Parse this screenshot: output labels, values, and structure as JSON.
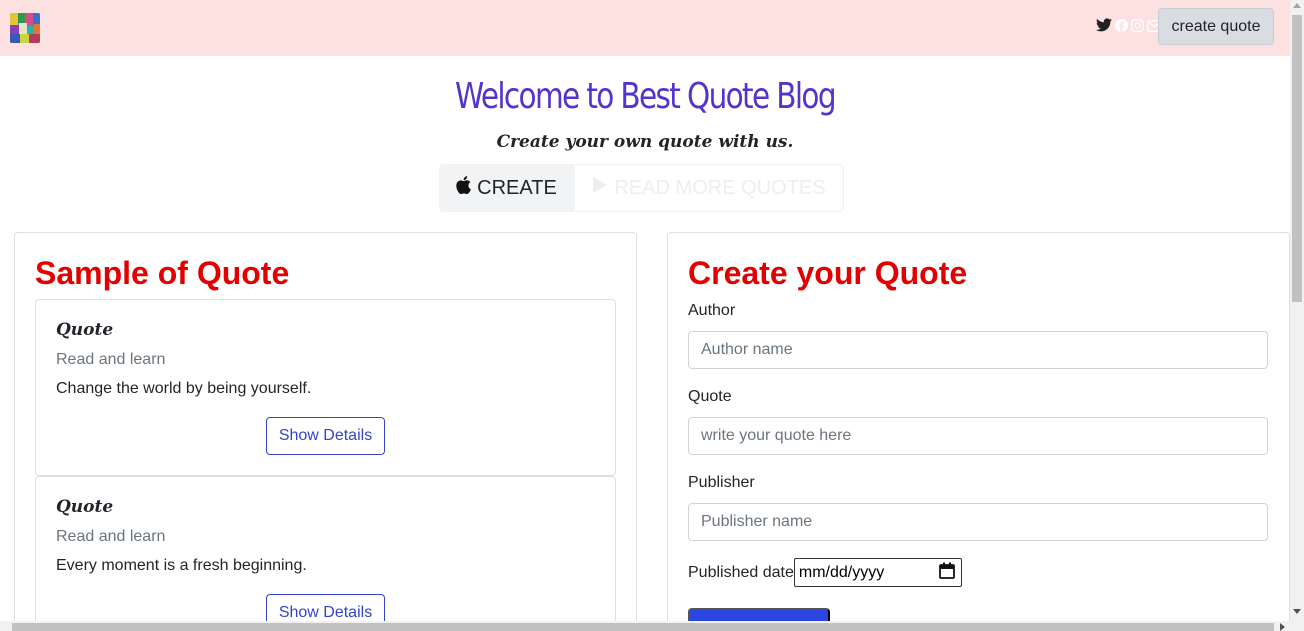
{
  "navbar": {
    "logo_icon": "quote-collage-logo",
    "social_icons": [
      "twitter-icon",
      "facebook-icon",
      "instagram-icon",
      "mail-icon"
    ],
    "create_quote_label": "create quote",
    "background_color": "#fde0e0"
  },
  "hero": {
    "title": "Welcome to Best Quote Blog",
    "subtitle": "Create your own quote with us.",
    "create_label": "CREATE",
    "read_more_label": "READ MORE QUOTES",
    "title_color": "#5533cc"
  },
  "samples": {
    "heading": "Sample of Quote",
    "cards": [
      {
        "title": "Quote",
        "subtitle": "Read and learn",
        "text": "Change the world by being yourself.",
        "button_label": "Show Details"
      },
      {
        "title": "Quote",
        "subtitle": "Read and learn",
        "text": "Every moment is a fresh beginning.",
        "button_label": "Show Details"
      }
    ]
  },
  "form": {
    "heading": "Create your Quote",
    "author_label": "Author",
    "author_placeholder": "Author name",
    "quote_label": "Quote",
    "quote_placeholder": "write your quote here",
    "publisher_label": "Publisher",
    "publisher_placeholder": "Publisher name",
    "date_label": "Published date",
    "date_placeholder": "mm/dd/yyyy",
    "submit_color": "#2a45e0"
  },
  "colors": {
    "heading_red": "#e20000",
    "button_blue": "#3344cc"
  }
}
